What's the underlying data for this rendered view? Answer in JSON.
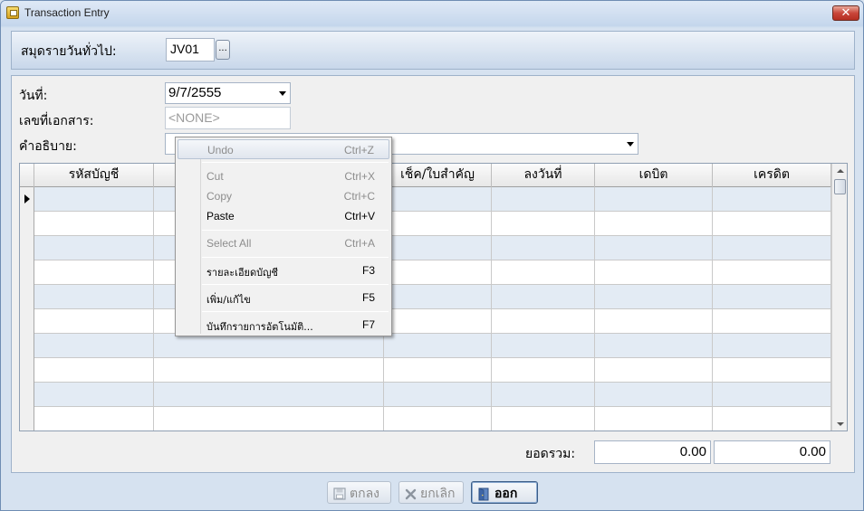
{
  "window": {
    "title": "Transaction Entry",
    "close_symbol": "✕"
  },
  "journal": {
    "label": "สมุดรายวันทั่วไป:",
    "value": "JV01",
    "browse_label": "..."
  },
  "form": {
    "date_label": "วันที่:",
    "date_value": "9/7/2555",
    "doc_label": "เลขที่เอกสาร:",
    "doc_value": "<NONE>",
    "desc_label": "คำอธิบาย:",
    "desc_value": ""
  },
  "grid": {
    "columns": [
      "รหัสบัญชี",
      "",
      "เช็ค/ใบสำคัญ",
      "ลงวันที่",
      "เดบิต",
      "เครดิต"
    ]
  },
  "totals": {
    "label": "ยอดรวม:",
    "debit": "0.00",
    "credit": "0.00"
  },
  "buttons": {
    "ok": "ตกลง",
    "cancel": "ยกเลิก",
    "exit": "ออก"
  },
  "context_menu": {
    "items": [
      {
        "label": "Undo",
        "shortcut": "Ctrl+Z"
      },
      {
        "label": "Cut",
        "shortcut": "Ctrl+X"
      },
      {
        "label": "Copy",
        "shortcut": "Ctrl+C"
      },
      {
        "label": "Paste",
        "shortcut": "Ctrl+V"
      },
      {
        "label": "Select All",
        "shortcut": "Ctrl+A"
      },
      {
        "label": "รายละเอียดบัญชี",
        "shortcut": "F3"
      },
      {
        "label": "เพิ่ม/แก้ไข",
        "shortcut": "F5"
      },
      {
        "label": "บันทึกรายการอัตโนมัติ...",
        "shortcut": "F7"
      }
    ]
  },
  "colors": {
    "accent": "#3b5c85",
    "row_alt": "#e3ebf4"
  }
}
